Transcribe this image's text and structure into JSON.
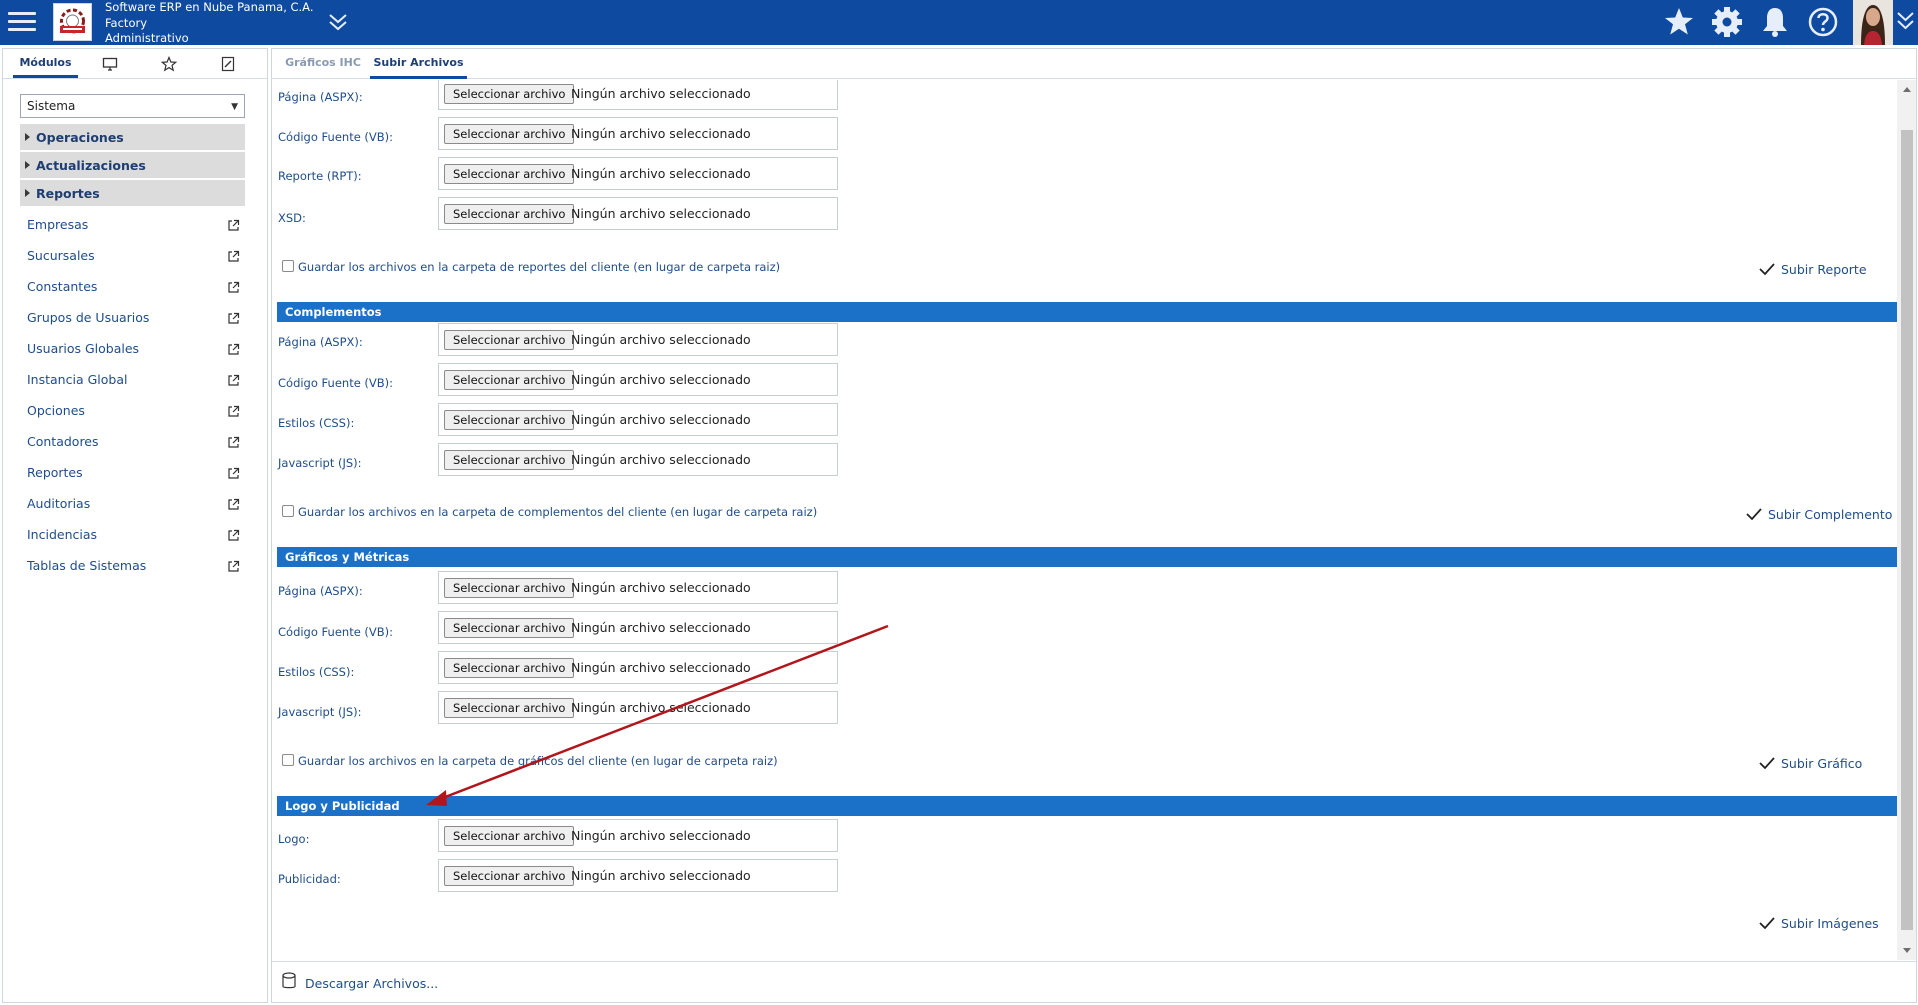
{
  "header": {
    "company_line1": "Software ERP en Nube Panama, C.A.",
    "company_line2": "Factory",
    "company_line3": "Administrativo",
    "bg_color": "#0f4aa1",
    "icons": [
      "menu-icon",
      "company-logo",
      "chevron-double-down-icon",
      "star-icon",
      "gear-icon",
      "bell-icon",
      "help-icon",
      "avatar",
      "chevron-double-down-icon"
    ]
  },
  "sidebar": {
    "tabs": {
      "modules_label": "Módulos"
    },
    "select_value": "Sistema",
    "groups": [
      {
        "label": "Operaciones"
      },
      {
        "label": "Actualizaciones"
      },
      {
        "label": "Reportes"
      }
    ],
    "items": [
      {
        "label": "Empresas"
      },
      {
        "label": "Sucursales"
      },
      {
        "label": "Constantes"
      },
      {
        "label": "Grupos de Usuarios"
      },
      {
        "label": "Usuarios Globales"
      },
      {
        "label": "Instancia Global"
      },
      {
        "label": "Opciones"
      },
      {
        "label": "Contadores"
      },
      {
        "label": "Reportes"
      },
      {
        "label": "Auditorias"
      },
      {
        "label": "Incidencias"
      },
      {
        "label": "Tablas de Sistemas"
      }
    ]
  },
  "main": {
    "tabs": [
      {
        "label": "Gráficos IHC",
        "active": false
      },
      {
        "label": "Subir Archivos",
        "active": true
      }
    ],
    "file_button_label": "Seleccionar archivo",
    "file_status": "Ningún archivo seleccionado",
    "reportes": {
      "fields": [
        "Página (ASPX):",
        "Código Fuente (VB):",
        "Reporte (RPT):",
        "XSD:"
      ],
      "checkbox_label": "Guardar los archivos en la carpeta de reportes del cliente (en lugar de carpeta raiz)",
      "action_label": "Subir Reporte"
    },
    "complementos": {
      "title": "Complementos",
      "fields": [
        "Página (ASPX):",
        "Código Fuente (VB):",
        "Estilos (CSS):",
        "Javascript (JS):"
      ],
      "checkbox_label": "Guardar los archivos en la carpeta de complementos del cliente (en lugar de carpeta raiz)",
      "action_label": "Subir Complemento"
    },
    "graficos": {
      "title": "Gráficos y Métricas",
      "fields": [
        "Página (ASPX):",
        "Código Fuente (VB):",
        "Estilos (CSS):",
        "Javascript (JS):"
      ],
      "checkbox_label": "Guardar los archivos en la carpeta de gráficos del cliente (en lugar de carpeta raiz)",
      "action_label": "Subir Gráfico"
    },
    "logo": {
      "title": "Logo y Publicidad",
      "fields": [
        "Logo:",
        "Publicidad:"
      ],
      "action_label": "Subir Imágenes"
    },
    "footer_link": "Descargar Archivos...",
    "section_color": "#1b70c8",
    "annotation_arrow_color": "#b0161b"
  }
}
